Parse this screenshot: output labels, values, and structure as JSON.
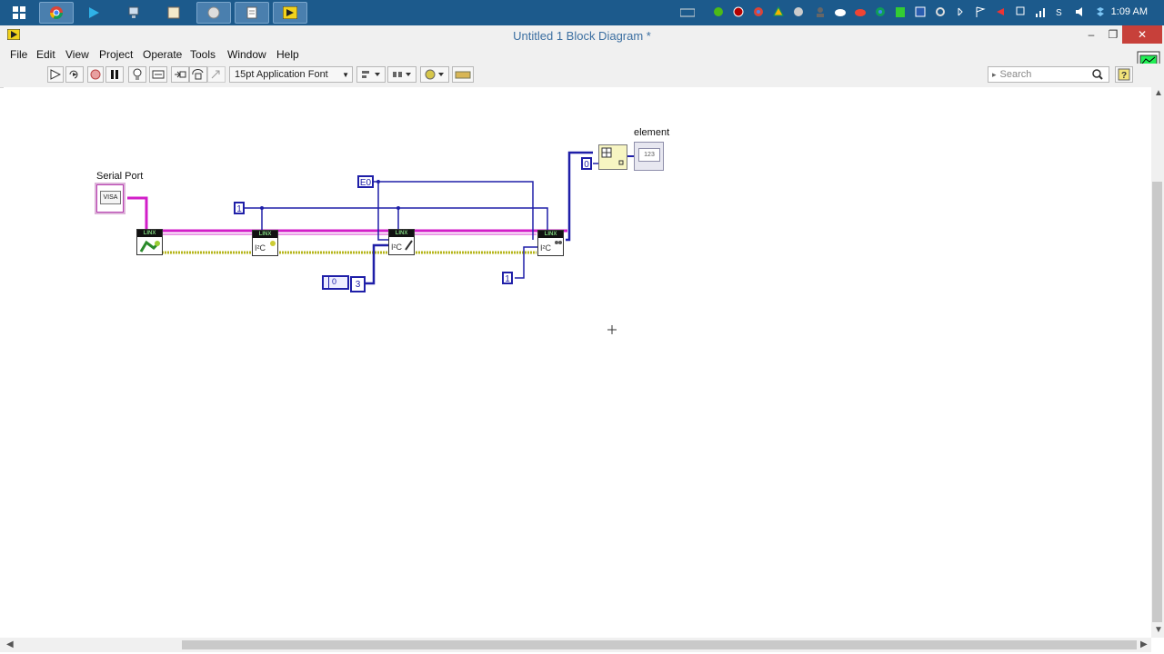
{
  "taskbar": {
    "clock": "1:09 AM",
    "buttons": [
      "windows-start",
      "chrome",
      "play",
      "network",
      "notepad",
      "app",
      "app",
      "labview"
    ]
  },
  "window": {
    "title": "Untitled 1 Block Diagram *",
    "minimize": "–",
    "maximize": "❐",
    "close": "✕"
  },
  "menu": {
    "items": [
      "File",
      "Edit",
      "View",
      "Project",
      "Operate",
      "Tools",
      "Window",
      "Help"
    ]
  },
  "toolbar": {
    "font": "15pt Application Font",
    "search_placeholder": "Search"
  },
  "diagram": {
    "serial_port_label": "Serial Port",
    "visa_text": "VISA",
    "element_label": "element",
    "indicator_text": "123",
    "subvi_header": "LINX",
    "const_one_a": "1",
    "const_e0": "E0",
    "const_one_b": "1",
    "const_zero": "0",
    "array_zero": "0",
    "array_three": "3"
  },
  "colors": {
    "taskbar": "#1c5a8c",
    "visa_wire": "#d21ec8",
    "error_wire": "#b5b51a",
    "numeric_wire": "#1f1fa8"
  }
}
